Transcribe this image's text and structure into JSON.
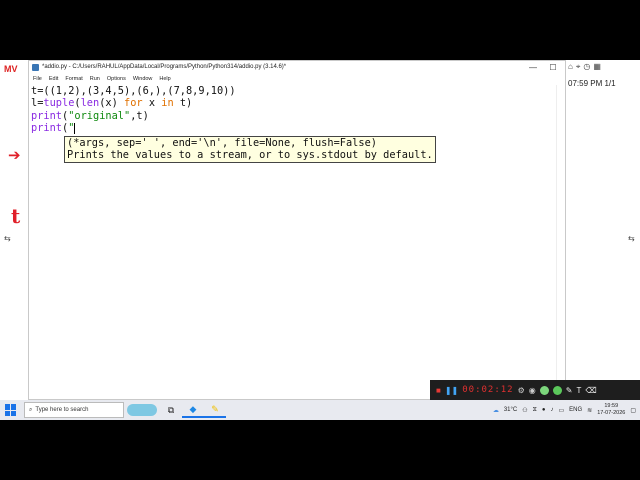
{
  "left_strip": {
    "logo": "MV"
  },
  "window": {
    "title": "*addio.py - C:/Users/RAHUL/AppData/Local/Programs/Python/Python314/addio.py (3.14.6)*",
    "controls": {
      "minimize": "—",
      "maximize": "☐",
      "close": "✕"
    },
    "menu": [
      "File",
      "Edit",
      "Format",
      "Run",
      "Options",
      "Window",
      "Help"
    ]
  },
  "editor": {
    "lines": [
      "t=((1,2),(3,4,5),(6,),(7,8,9,10))",
      "l=tuple(len(x) for x in t)",
      "print(\"original\",t)",
      "print(\""
    ]
  },
  "calltip": {
    "lines": [
      "(*args, sep=' ', end='\\n', file=None, flush=False)",
      "Prints the values to a stream, or to sys.stdout by default."
    ]
  },
  "right_panel": {
    "time": "07:59 PM 1/1"
  },
  "recorder": {
    "timer": "00:02:12"
  },
  "taskbar": {
    "search_placeholder": "Type here to search",
    "weather": "31°C",
    "language": "ENG",
    "clock_time": "19:59",
    "clock_date": "17-07-2026"
  },
  "colors": {
    "keyword": "#e07000",
    "builtin": "#8a2be2",
    "string": "#108a10",
    "annotation": "#e0202a"
  }
}
